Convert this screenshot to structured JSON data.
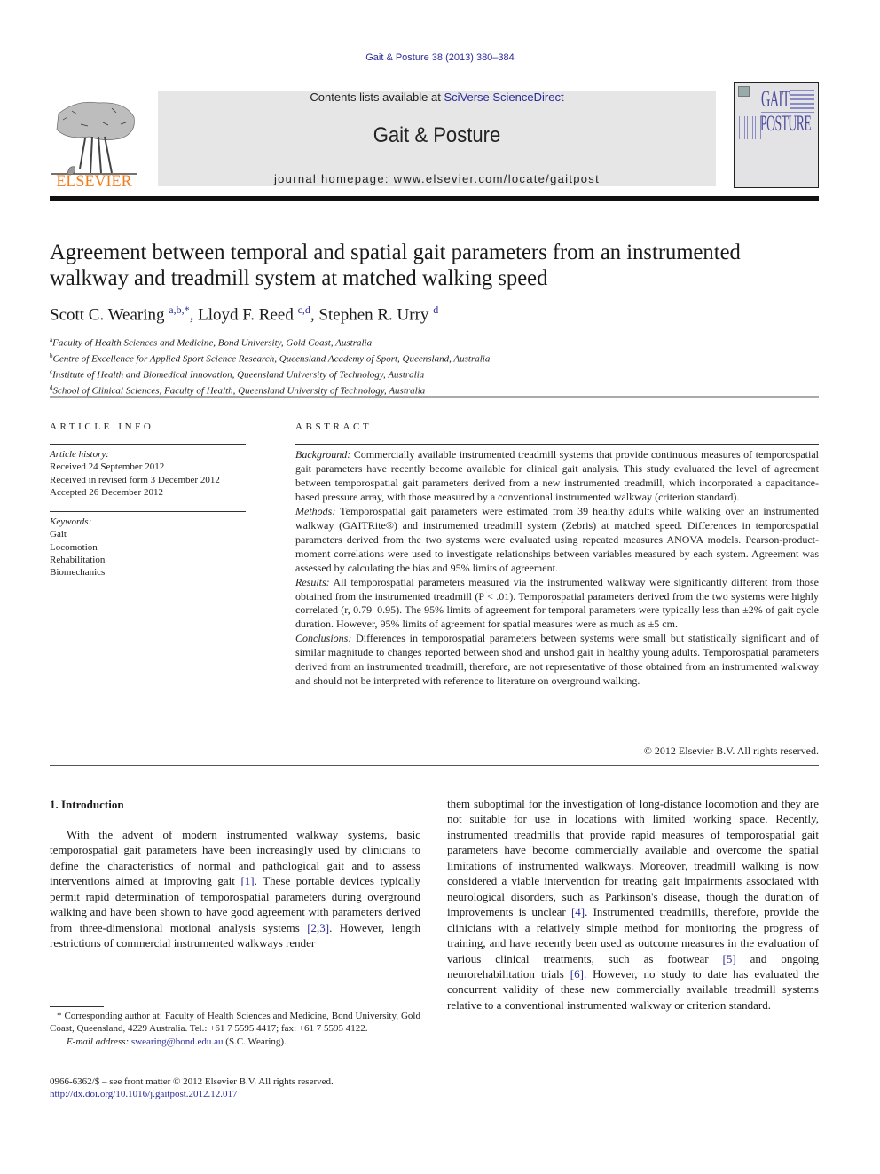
{
  "running_head": "Gait & Posture 38 (2013) 380–384",
  "masthead": {
    "contents_prefix": "Contents lists available at ",
    "contents_link": "SciVerse ScienceDirect",
    "journal_title": "Gait & Posture",
    "homepage": "journal homepage: www.elsevier.com/locate/gaitpost",
    "publisher_logo_text": "ELSEVIER",
    "cover_title_top": "GAIT",
    "cover_title_bottom": "POSTURE",
    "publisher_color": "#f07c1c",
    "link_color": "#2a2a9a"
  },
  "article": {
    "title_line1": "Agreement between temporal and spatial gait parameters from an instrumented",
    "title_line2": "walkway and treadmill system at matched walking speed",
    "authors": [
      {
        "name": "Scott C. Wearing",
        "sup": "a,b,*"
      },
      {
        "name": "Lloyd F. Reed",
        "sup": "c,d"
      },
      {
        "name": "Stephen R. Urry",
        "sup": "d"
      }
    ],
    "affiliations": [
      {
        "key": "a",
        "text": "Faculty of Health Sciences and Medicine, Bond University, Gold Coast, Australia"
      },
      {
        "key": "b",
        "text": "Centre of Excellence for Applied Sport Science Research, Queensland Academy of Sport, Queensland, Australia"
      },
      {
        "key": "c",
        "text": "Institute of Health and Biomedical Innovation, Queensland University of Technology, Australia"
      },
      {
        "key": "d",
        "text": "School of Clinical Sciences, Faculty of Health, Queensland University of Technology, Australia"
      }
    ]
  },
  "article_info": {
    "heading": "ARTICLE INFO",
    "history_label": "Article history:",
    "history": [
      "Received 24 September 2012",
      "Received in revised form 3 December 2012",
      "Accepted 26 December 2012"
    ],
    "keywords_label": "Keywords:",
    "keywords": [
      "Gait",
      "Locomotion",
      "Rehabilitation",
      "Biomechanics"
    ]
  },
  "abstract": {
    "heading": "ABSTRACT",
    "sections": [
      {
        "label": "Background:",
        "text": "Commercially available instrumented treadmill systems that provide continuous measures of temporospatial gait parameters have recently become available for clinical gait analysis. This study evaluated the level of agreement between temporospatial gait parameters derived from a new instrumented treadmill, which incorporated a capacitance-based pressure array, with those measured by a conventional instrumented walkway (criterion standard)."
      },
      {
        "label": "Methods:",
        "text": "Temporospatial gait parameters were estimated from 39 healthy adults while walking over an instrumented walkway (GAITRite®) and instrumented treadmill system (Zebris) at matched speed. Differences in temporospatial parameters derived from the two systems were evaluated using repeated measures ANOVA models. Pearson-product-moment correlations were used to investigate relationships between variables measured by each system. Agreement was assessed by calculating the bias and 95% limits of agreement."
      },
      {
        "label": "Results:",
        "text": "All temporospatial parameters measured via the instrumented walkway were significantly different from those obtained from the instrumented treadmill (P < .01). Temporospatial parameters derived from the two systems were highly correlated (r, 0.79–0.95). The 95% limits of agreement for temporal parameters were typically less than ±2% of gait cycle duration. However, 95% limits of agreement for spatial measures were as much as ±5 cm."
      },
      {
        "label": "Conclusions:",
        "text": "Differences in temporospatial parameters between systems were small but statistically significant and of similar magnitude to changes reported between shod and unshod gait in healthy young adults. Temporospatial parameters derived from an instrumented treadmill, therefore, are not representative of those obtained from an instrumented walkway and should not be interpreted with reference to literature on overground walking."
      }
    ],
    "copyright": "© 2012 Elsevier B.V. All rights reserved."
  },
  "body": {
    "section_heading": "1.  Introduction",
    "left_segments": [
      {
        "t": "With the advent of modern instrumented walkway systems, basic temporospatial gait parameters have been increasingly used by clinicians to define the characteristics of normal and pathological gait and to assess interventions aimed at improving gait "
      },
      {
        "ref": "[1]"
      },
      {
        "t": ". These portable devices typically permit rapid determination of temporospatial parameters during overground walking and have been shown to have good agreement with parameters derived from three-dimensional motional analysis systems "
      },
      {
        "ref": "[2,3]"
      },
      {
        "t": ". However, length restrictions of commercial instrumented walkways render"
      }
    ],
    "right_segments": [
      {
        "t": "them suboptimal for the investigation of long-distance locomotion and they are not suitable for use in locations with limited working space. Recently, instrumented treadmills that provide rapid measures of temporospatial gait parameters have become commercially available and overcome the spatial limitations of instrumented walkways. Moreover, treadmill walking is now considered a viable intervention for treating gait impairments associated with neurological disorders, such as Parkinson's disease, though the duration of improvements is unclear "
      },
      {
        "ref": "[4]"
      },
      {
        "t": ". Instrumented treadmills, therefore, provide the clinicians with a relatively simple method for monitoring the progress of training, and have recently been used as outcome measures in the evaluation of various clinical treatments, such as footwear "
      },
      {
        "ref": "[5]"
      },
      {
        "t": " and ongoing neurorehabilitation trials "
      },
      {
        "ref": "[6]"
      },
      {
        "t": ". However, no study to date has evaluated the concurrent validity of these new commercially available treadmill systems relative to a conventional instrumented walkway or criterion standard."
      }
    ]
  },
  "footnote": {
    "corresponding": "* Corresponding author at: Faculty of Health Sciences and Medicine, Bond University, Gold Coast, Queensland, 4229 Australia. Tel.: +61 7 5595 4417; fax: +61 7 5595 4122.",
    "email_label": "E-mail address:",
    "email": "swearing@bond.edu.au",
    "email_suffix": " (S.C. Wearing).",
    "front_matter": "0966-6362/$ – see front matter © 2012 Elsevier B.V. All rights reserved.",
    "doi": "http://dx.doi.org/10.1016/j.gaitpost.2012.12.017"
  }
}
